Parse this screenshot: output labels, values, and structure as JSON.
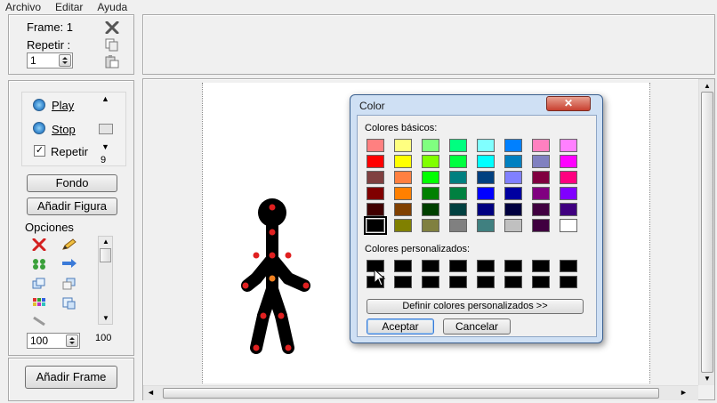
{
  "menu": [
    "Archivo",
    "Editar",
    "Ayuda"
  ],
  "frame_panel": {
    "frame_label": "Frame: 1",
    "repeat_label": "Repetir :",
    "repeat_value": "1"
  },
  "playback": {
    "play_label": "Play",
    "stop_label": "Stop",
    "repeat_label": "Repetir",
    "repeat_count": "9"
  },
  "buttons": {
    "background": "Fondo",
    "add_figure": "Añadir Figura",
    "add_frame": "Añadir Frame"
  },
  "options": {
    "title": "Opciones",
    "value": "100",
    "scale_value": "100"
  },
  "dialog": {
    "title": "Color",
    "basic_label": "Colores básicos:",
    "custom_label": "Colores personalizados:",
    "define_button": "Definir colores personalizados >>",
    "accept_button": "Aceptar",
    "cancel_button": "Cancelar",
    "basic_colors": [
      "#ff8080",
      "#ffff80",
      "#80ff80",
      "#00ff80",
      "#80ffff",
      "#0080ff",
      "#ff80c0",
      "#ff80ff",
      "#ff0000",
      "#ffff00",
      "#80ff00",
      "#00ff40",
      "#00ffff",
      "#0080c0",
      "#8080c0",
      "#ff00ff",
      "#804040",
      "#ff8040",
      "#00ff00",
      "#008080",
      "#004080",
      "#8080ff",
      "#800040",
      "#ff0080",
      "#800000",
      "#ff8000",
      "#008000",
      "#008040",
      "#0000ff",
      "#0000a0",
      "#800080",
      "#8000ff",
      "#400000",
      "#804000",
      "#004000",
      "#004040",
      "#000080",
      "#000040",
      "#400040",
      "#400080",
      "#000000",
      "#808000",
      "#808040",
      "#808080",
      "#408080",
      "#c0c0c0",
      "#400040",
      "#ffffff"
    ],
    "selected_basic_index": 40,
    "custom_colors_count": 16
  },
  "figure": {
    "body_color": "#000000",
    "joint_color": "#e02020",
    "center_joint_color": "#f08020"
  }
}
